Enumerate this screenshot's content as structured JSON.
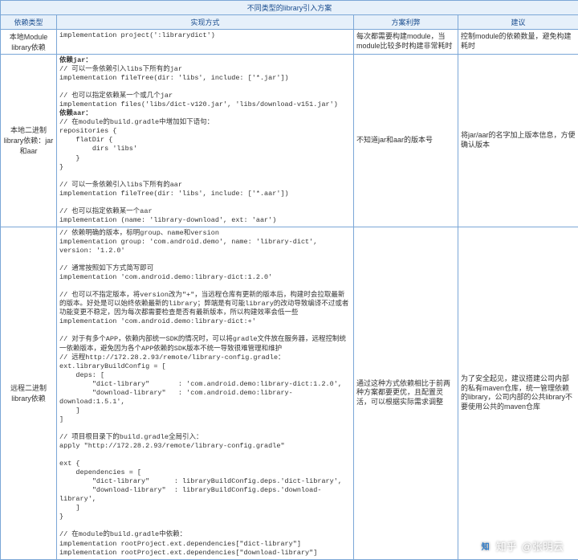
{
  "title": "不同类型的library引入方案",
  "headers": {
    "c1": "依赖类型",
    "c2": "实现方式",
    "c3": "方案利弊",
    "c4": "建议"
  },
  "rows": [
    {
      "type": "本地Module library依赖",
      "impl": "implementation project(':librarydict')",
      "adv": "每次都需要构建module，当module比较多时构建非常耗时",
      "rec": "控制module的依赖数量，避免构建耗时"
    },
    {
      "type": "本地二进制library依赖：jar和aar",
      "impl_label_jar": "依赖jar：",
      "impl_jar": "// 可以一条依赖引入libs下所有的jar\nimplementation fileTree(dir: 'libs', include: ['*.jar'])\n\n// 也可以指定依赖某一个或几个jar\nimplementation files('libs/dict-v120.jar', 'libs/download-v151.jar')",
      "impl_label_aar": "依赖aar：",
      "impl_aar": "// 在module的build.gradle中增加如下语句：\nrepositories {\n    flatDir {\n        dirs 'libs'\n    }\n}\n\n// 可以一条依赖引入libs下所有的aar\nimplementation fileTree(dir: 'libs', include: ['*.aar'])\n\n// 也可以指定依赖某一个aar\nimplementation (name: 'library-download', ext: 'aar')",
      "adv": "不知道jar和aar的版本号",
      "rec": "将jar/aar的名字加上版本信息，方便确认版本"
    },
    {
      "type": "远程二进制library依赖",
      "impl": "// 依赖明确的版本，标明group、name和version\nimplementation group: 'com.android.demo', name: 'library-dict', version: '1.2.0'\n\n// 通常按照如下方式简写即可\nimplementation 'com.android.demo:library-dict:1.2.0'\n\n// 也可以不指定版本，将version改为\"+\"，当远程仓库有更新的版本后，构建时会拉取最新的版本。好处是可以始终依赖最新的library；弊端是有可能library的改动导致编译不过或者功能变更不稳定，因为每次都需要检查是否有最新版本，所以构建效率会低一些\nimplementation 'com.android.demo:library-dict:+'\n\n// 对于有多个APP，依赖内部统一SDK的情况时，可以将gradle文件放在服务器，远程控制统一依赖版本，避免因为各个APP依赖的SDK版本不统一导致很难管理和维护\n// 远程http://172.28.2.93/remote/library-config.gradle：\next.libraryBuildConfig = [\n    deps: [\n        \"dict-library\"       : 'com.android.demo:library-dict:1.2.0',\n        \"download-library\"   : 'com.android.demo:library-download:1.5.1',\n    ]\n]\n\n// 项目根目录下的build.gradle全局引入：\napply \"http://172.28.2.93/remote/library-config.gradle\"\n\next {\n    dependencies = [\n        \"dict-library\"      : libraryBuildConfig.deps.'dict-library',\n        \"download-library\"  : libraryBuildConfig.deps.'download-library',\n    ]\n}\n\n// 在module的build.gradle中依赖：\nimplementation rootProject.ext.dependencies[\"dict-library\"]\nimplementation rootProject.ext.dependencies[\"download-library\"]",
      "adv": "通过这种方式依赖相比于前两种方案都要更优，且配置灵活，可以根据实际需求调整",
      "rec": "为了安全起见，建议搭建公司内部的私有maven仓库，统一管理依赖的library，公司内部的公共library不要使用公共的maven仓库"
    }
  ],
  "watermark": {
    "logo": "知",
    "site": "知乎",
    "author": "@张明云"
  }
}
